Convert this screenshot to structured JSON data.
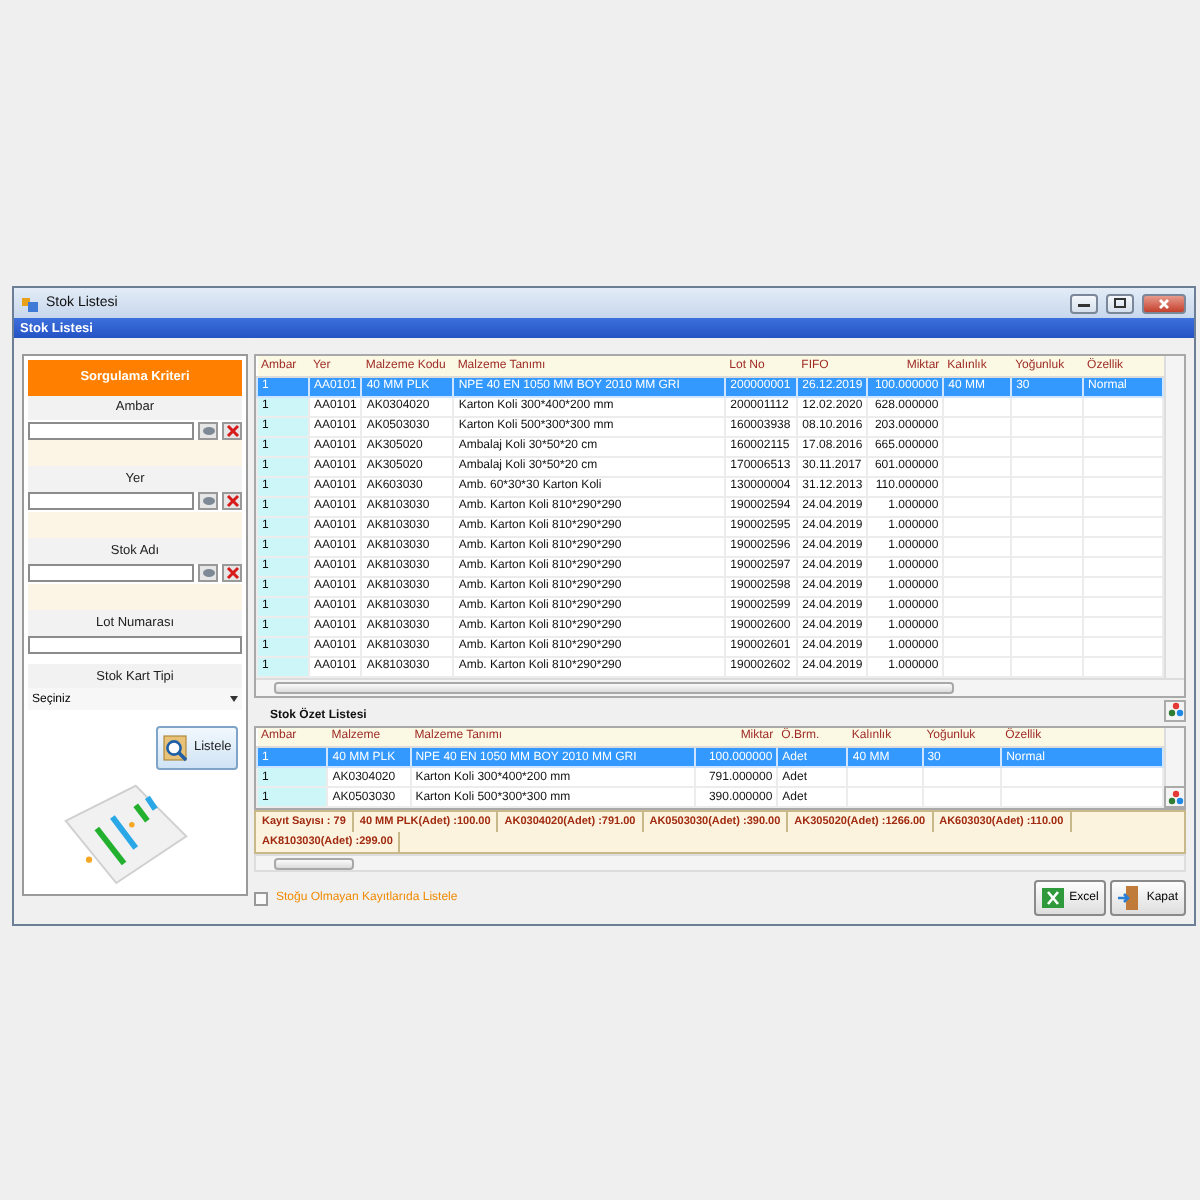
{
  "window": {
    "title": "Stok Listesi"
  },
  "header": {
    "title": "Stok Listesi"
  },
  "filters": {
    "title": "Sorgulama Kriteri",
    "fields": [
      {
        "kind": "lookup",
        "label": "Ambar"
      },
      {
        "kind": "lookup",
        "label": "Yer"
      },
      {
        "kind": "lookup",
        "label": "Stok Adı"
      },
      {
        "kind": "text",
        "label": "Lot Numarası"
      },
      {
        "kind": "select",
        "label": "Stok Kart Tipi",
        "value": "Seçiniz"
      }
    ],
    "button": "Listele"
  },
  "stock_table": {
    "columns": [
      "Ambar",
      "Yer",
      "Malzeme Kodu",
      "Malzeme Tanımı",
      "Lot No",
      "FIFO",
      "Miktar",
      "Kalınlık",
      "Yoğunluk",
      "Özellik"
    ],
    "rows": [
      {
        "selected": true,
        "cells": [
          "1",
          "AA0101",
          "40 MM PLK",
          "NPE 40 EN 1050 MM BOY 2010 MM GRI",
          "200000001",
          "26.12.2019",
          "100.000000",
          "40 MM",
          "30",
          "Normal"
        ]
      },
      {
        "selected": false,
        "cells": [
          "1",
          "AA0101",
          "AK0304020",
          "Karton Koli 300*400*200 mm",
          "200001112",
          "12.02.2020",
          "628.000000"
        ]
      },
      {
        "selected": false,
        "cells": [
          "1",
          "AA0101",
          "AK0503030",
          "Karton Koli 500*300*300 mm",
          "160003938",
          "08.10.2016",
          "203.000000"
        ]
      },
      {
        "selected": false,
        "cells": [
          "1",
          "AA0101",
          "AK305020",
          "Ambalaj Koli 30*50*20 cm",
          "160002115",
          "17.08.2016",
          "665.000000"
        ]
      },
      {
        "selected": false,
        "cells": [
          "1",
          "AA0101",
          "AK305020",
          "Ambalaj Koli 30*50*20 cm",
          "170006513",
          "30.11.2017",
          "601.000000"
        ]
      },
      {
        "selected": false,
        "cells": [
          "1",
          "AA0101",
          "AK603030",
          "Amb. 60*30*30 Karton Koli",
          "130000004",
          "31.12.2013",
          "110.000000"
        ]
      },
      {
        "selected": false,
        "cells": [
          "1",
          "AA0101",
          "AK8103030",
          "Amb. Karton Koli 810*290*290",
          "190002594",
          "24.04.2019",
          "1.000000"
        ]
      },
      {
        "selected": false,
        "cells": [
          "1",
          "AA0101",
          "AK8103030",
          "Amb. Karton Koli 810*290*290",
          "190002595",
          "24.04.2019",
          "1.000000"
        ]
      },
      {
        "selected": false,
        "cells": [
          "1",
          "AA0101",
          "AK8103030",
          "Amb. Karton Koli 810*290*290",
          "190002596",
          "24.04.2019",
          "1.000000"
        ]
      },
      {
        "selected": false,
        "cells": [
          "1",
          "AA0101",
          "AK8103030",
          "Amb. Karton Koli 810*290*290",
          "190002597",
          "24.04.2019",
          "1.000000"
        ]
      },
      {
        "selected": false,
        "cells": [
          "1",
          "AA0101",
          "AK8103030",
          "Amb. Karton Koli 810*290*290",
          "190002598",
          "24.04.2019",
          "1.000000"
        ]
      },
      {
        "selected": false,
        "cells": [
          "1",
          "AA0101",
          "AK8103030",
          "Amb. Karton Koli 810*290*290",
          "190002599",
          "24.04.2019",
          "1.000000"
        ]
      },
      {
        "selected": false,
        "cells": [
          "1",
          "AA0101",
          "AK8103030",
          "Amb. Karton Koli 810*290*290",
          "190002600",
          "24.04.2019",
          "1.000000"
        ]
      },
      {
        "selected": false,
        "cells": [
          "1",
          "AA0101",
          "AK8103030",
          "Amb. Karton Koli 810*290*290",
          "190002601",
          "24.04.2019",
          "1.000000"
        ]
      },
      {
        "selected": false,
        "cells": [
          "1",
          "AA0101",
          "AK8103030",
          "Amb. Karton Koli 810*290*290",
          "190002602",
          "24.04.2019",
          "1.000000"
        ]
      }
    ]
  },
  "summary": {
    "title": "Stok Özet Listesi",
    "columns": [
      "Ambar",
      "Malzeme",
      "Malzeme Tanımı",
      "Miktar",
      "Ö.Brm.",
      "Kalınlık",
      "Yoğunluk",
      "Özellik"
    ],
    "rows": [
      {
        "selected": true,
        "cells": [
          "1",
          "40 MM PLK",
          "NPE 40 EN 1050 MM BOY 2010 MM GRI",
          "100.000000",
          "Adet",
          "40 MM",
          "30",
          "Normal"
        ]
      },
      {
        "selected": false,
        "cells": [
          "1",
          "AK0304020",
          "Karton Koli 300*400*200 mm",
          "791.000000",
          "Adet"
        ]
      },
      {
        "selected": false,
        "cells": [
          "1",
          "AK0503030",
          "Karton Koli 500*300*300 mm",
          "390.000000",
          "Adet"
        ]
      }
    ]
  },
  "totals": [
    "Kayıt Sayısı : 79",
    "40 MM PLK(Adet) :100.00",
    "AK0304020(Adet) :791.00",
    "AK0503030(Adet) :390.00",
    "AK305020(Adet) :1266.00",
    "AK603030(Adet) :110.00",
    "AK8103030(Adet) :299.00"
  ],
  "option": {
    "label": "Stoğu Olmayan Kayıtlarıda Listele",
    "checked": false
  },
  "buttons": [
    {
      "kind": "excel",
      "label": "Excel"
    },
    {
      "kind": "close",
      "label": "Kapat"
    }
  ]
}
